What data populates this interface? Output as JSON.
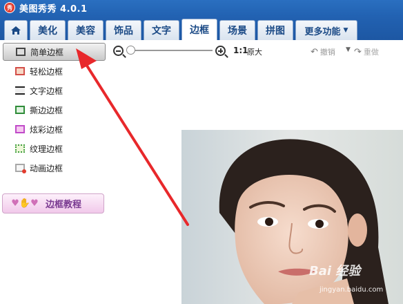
{
  "app": {
    "title": "美图秀秀 4.0.1",
    "logo_char": "秀"
  },
  "tabs": [
    {
      "label": "美化"
    },
    {
      "label": "美容"
    },
    {
      "label": "饰品"
    },
    {
      "label": "文字"
    },
    {
      "label": "边框",
      "active": true
    },
    {
      "label": "场景"
    },
    {
      "label": "拼图"
    },
    {
      "label": "更多功能"
    }
  ],
  "sidebar": {
    "items": [
      {
        "label": "简单边框",
        "icon": "simple-frame-icon",
        "active": true
      },
      {
        "label": "轻松边框",
        "icon": "light-frame-icon"
      },
      {
        "label": "文字边框",
        "icon": "text-frame-icon"
      },
      {
        "label": "撕边边框",
        "icon": "torn-edge-frame-icon"
      },
      {
        "label": "炫彩边框",
        "icon": "colorful-frame-icon"
      },
      {
        "label": "纹理边框",
        "icon": "texture-frame-icon"
      },
      {
        "label": "动画边框",
        "icon": "animated-frame-icon"
      }
    ],
    "tutorial_label": "边框教程"
  },
  "toolbar": {
    "ratio": "1:1",
    "original_label": "原大",
    "undo_label": "撤销",
    "redo_label": "重做"
  },
  "watermark": {
    "main": "Bai 经验",
    "sub": "jingyan.baidu.com"
  },
  "colors": {
    "titlebar": "#2262b2",
    "tab_text": "#1b4a86",
    "annotation_arrow": "#e8282b",
    "tutorial_text": "#7a3a91"
  }
}
